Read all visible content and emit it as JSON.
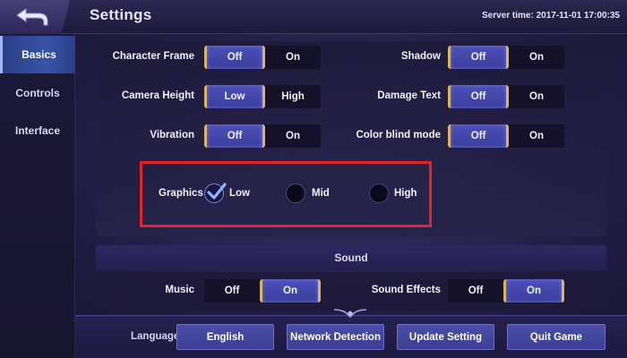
{
  "header": {
    "title": "Settings",
    "server_time": "Server time: 2017-11-01 17:00:35"
  },
  "sidebar": {
    "items": [
      {
        "label": "Basics",
        "active": true
      },
      {
        "label": "Controls",
        "active": false
      },
      {
        "label": "Interface",
        "active": false
      }
    ]
  },
  "settings": {
    "character_frame": {
      "label": "Character Frame",
      "options": [
        "Off",
        "On"
      ],
      "selected": "Off"
    },
    "camera_height": {
      "label": "Camera Height",
      "options": [
        "Low",
        "High"
      ],
      "selected": "Low"
    },
    "vibration": {
      "label": "Vibration",
      "options": [
        "Off",
        "On"
      ],
      "selected": "Off"
    },
    "shadow": {
      "label": "Shadow",
      "options": [
        "Off",
        "On"
      ],
      "selected": "Off"
    },
    "damage_text": {
      "label": "Damage Text",
      "options": [
        "Off",
        "On"
      ],
      "selected": "Off"
    },
    "color_blind_mode": {
      "label": "Color blind mode",
      "options": [
        "Off",
        "On"
      ],
      "selected": "Off"
    },
    "graphics": {
      "label": "Graphics",
      "options": [
        "Low",
        "Mid",
        "High"
      ],
      "selected": "Low"
    }
  },
  "sound": {
    "section_title": "Sound",
    "music": {
      "label": "Music",
      "options": [
        "Off",
        "On"
      ],
      "selected": "On"
    },
    "sound_effects": {
      "label": "Sound Effects",
      "options": [
        "Off",
        "On"
      ],
      "selected": "On"
    }
  },
  "footer": {
    "language_label": "Language",
    "language_value": "English",
    "network_detection": "Network Detection",
    "update_setting": "Update Setting",
    "quit_game": "Quit Game"
  },
  "colors": {
    "accent_selected": "#4c4fb8",
    "highlight_box": "#e1232b",
    "gold_edge": "#d8b466"
  }
}
